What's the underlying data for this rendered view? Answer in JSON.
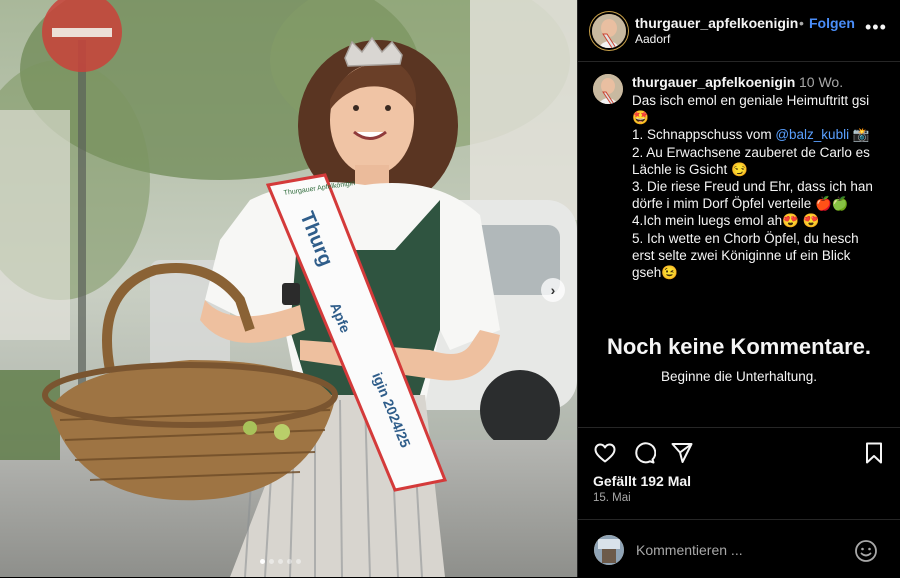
{
  "post": {
    "username": "thurgauer_apfelkoenigin",
    "separator": "•",
    "follow_label": "Folgen",
    "location": "Aadorf",
    "more_label": "•••"
  },
  "photo": {
    "sash_top": "Thurgauer Apfelkönigin",
    "sash_main": "Thurg",
    "sash_mid": "Apfe",
    "sash_bottom": "igin 2024/25",
    "next_label": "›",
    "slide_count": 5,
    "active_slide": 1
  },
  "caption": {
    "username": "thurgauer_apfelkoenigin",
    "time": "10 Wo.",
    "lines": [
      "Das isch emol en geniale Heimuftritt gsi",
      "🤩",
      "1. Schnappschuss vom ",
      "2. Au Erwachsene zauberet de Carlo es",
      "Lächle is Gsicht 😏",
      "3. Die riese Freud und Ehr, dass ich han",
      "dörfe i mim Dorf Öpfel verteile 🍎🍏",
      "4.Ich mein luegs emol ah😍 😍",
      "5. Ich wette en Chorb Öpfel, du hesch",
      "erst selte zwei Königinne uf ein Blick",
      "gseh😉"
    ],
    "mention": "@balz_kubli",
    "mention_suffix": " 📸"
  },
  "comments": {
    "empty_title": "Noch keine Kommentare.",
    "empty_subtitle": "Beginne die Unterhaltung."
  },
  "actions": {
    "likes": "Gefällt 192 Mal",
    "date": "15. Mai"
  },
  "composer": {
    "placeholder": "Kommentieren ..."
  },
  "colors": {
    "accent": "#4a8df8",
    "mention": "#5aa0ff",
    "muted": "#a8a8a8",
    "divider": "#262626"
  }
}
